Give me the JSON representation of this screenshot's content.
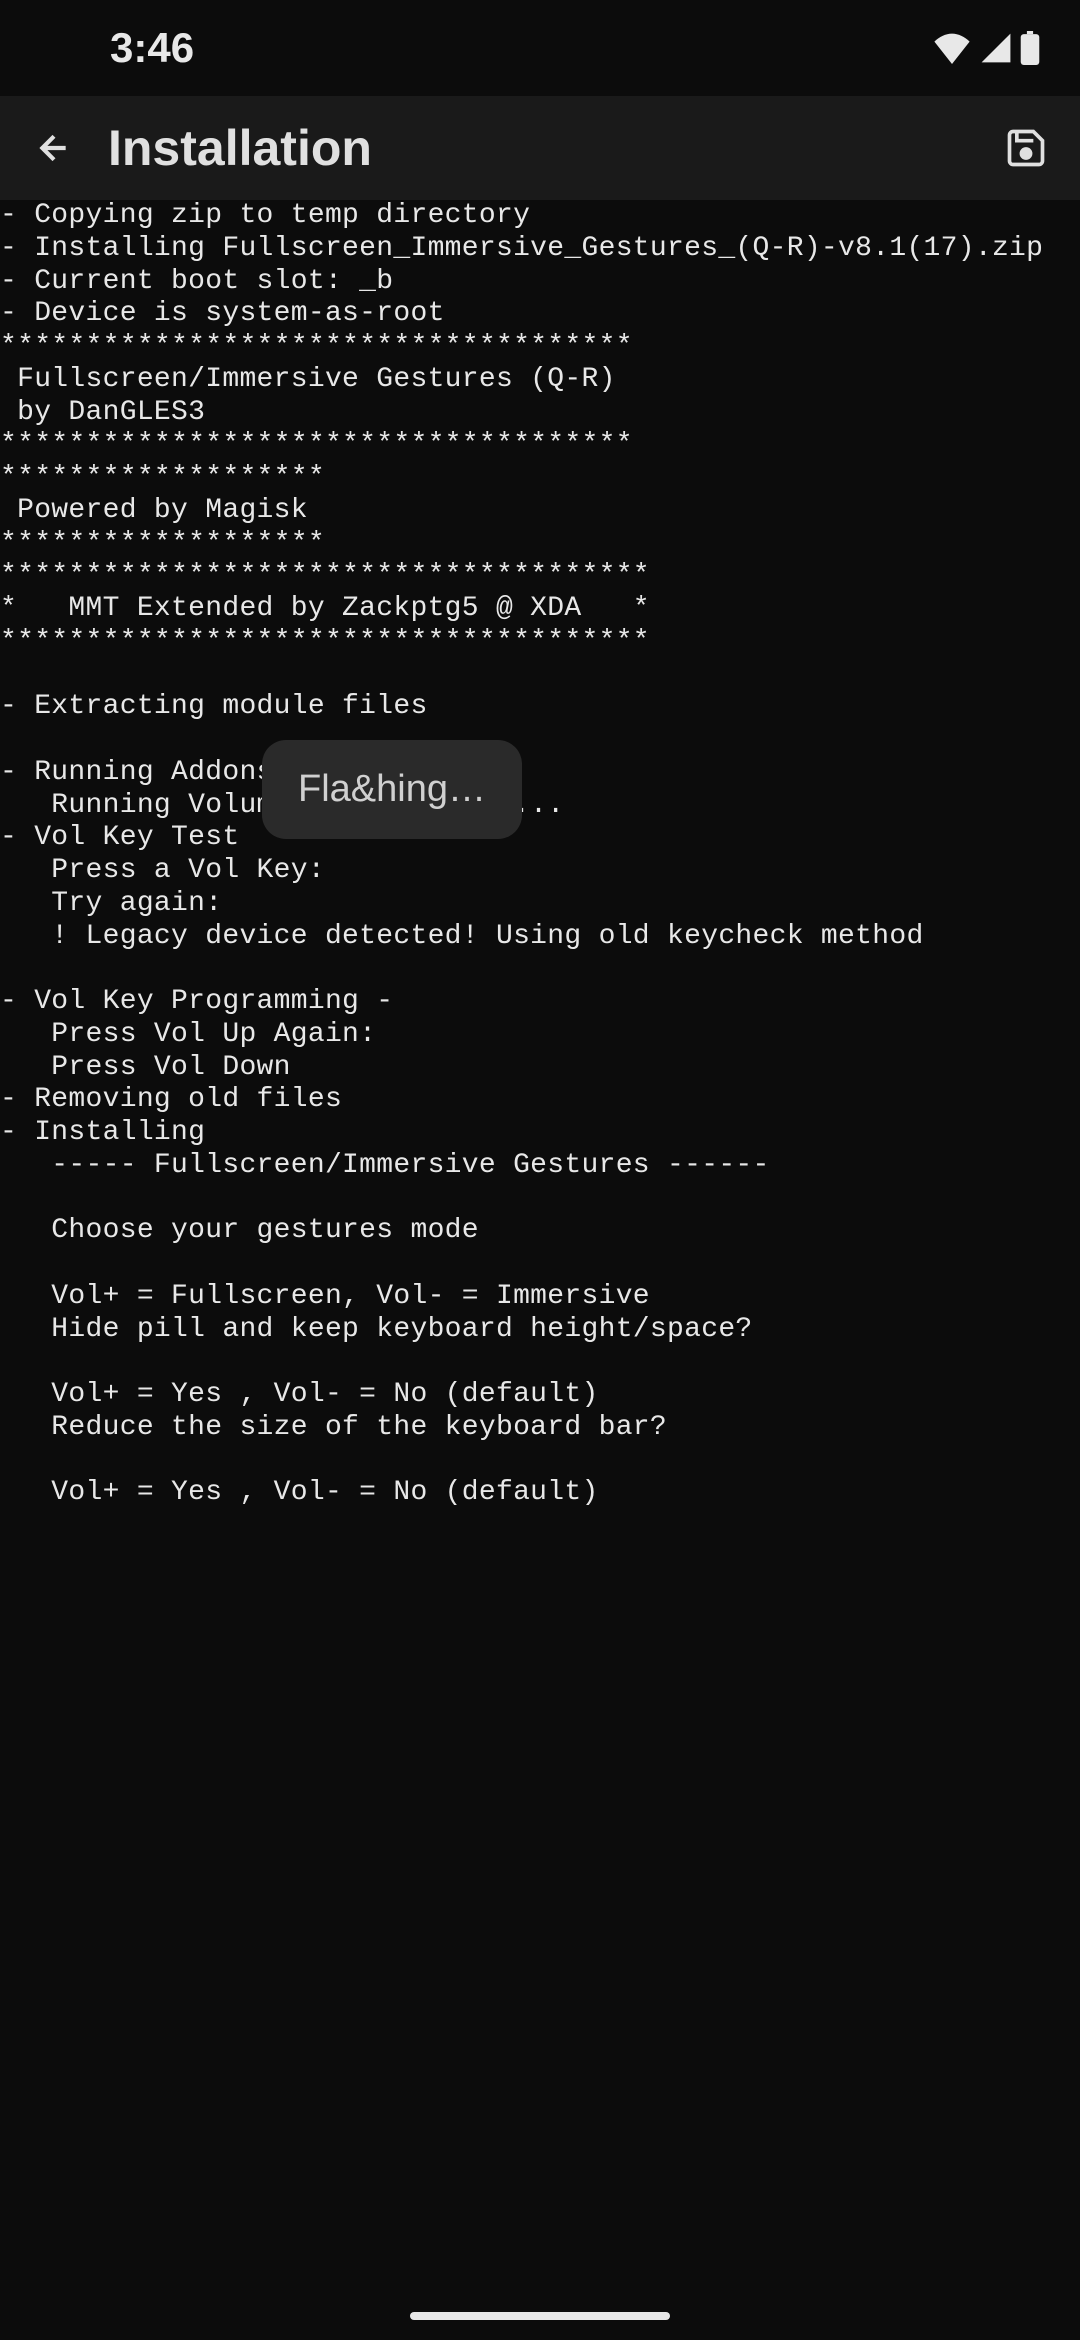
{
  "status": {
    "time": "3:46"
  },
  "appbar": {
    "title": "Installation"
  },
  "console": {
    "text": "- Copying zip to temp directory\n- Installing Fullscreen_Immersive_Gestures_(Q-R)-v8.1(17).zip\n- Current boot slot: _b\n- Device is system-as-root\n*************************************\n Fullscreen/Immersive Gestures (Q-R)\n by DanGLES3\n*************************************\n*******************\n Powered by Magisk\n*******************\n**************************************\n*   MMT Extended by Zackptg5 @ XDA   *\n**************************************\n\n- Extracting module files\n\n- Running Addons -\n   Running Volume-Key-Selector...\n- Vol Key Test\n   Press a Vol Key:\n   Try again:\n   ! Legacy device detected! Using old keycheck method\n\n- Vol Key Programming -\n   Press Vol Up Again:\n   Press Vol Down\n- Removing old files\n- Installing\n   ----- Fullscreen/Immersive Gestures ------\n\n   Choose your gestures mode\n\n   Vol+ = Fullscreen, Vol- = Immersive\n   Hide pill and keep keyboard height/space?\n\n   Vol+ = Yes , Vol- = No (default)\n   Reduce the size of the keyboard bar?\n\n   Vol+ = Yes , Vol- = No (default)"
  },
  "toast": {
    "text": "Fla&hing…"
  }
}
